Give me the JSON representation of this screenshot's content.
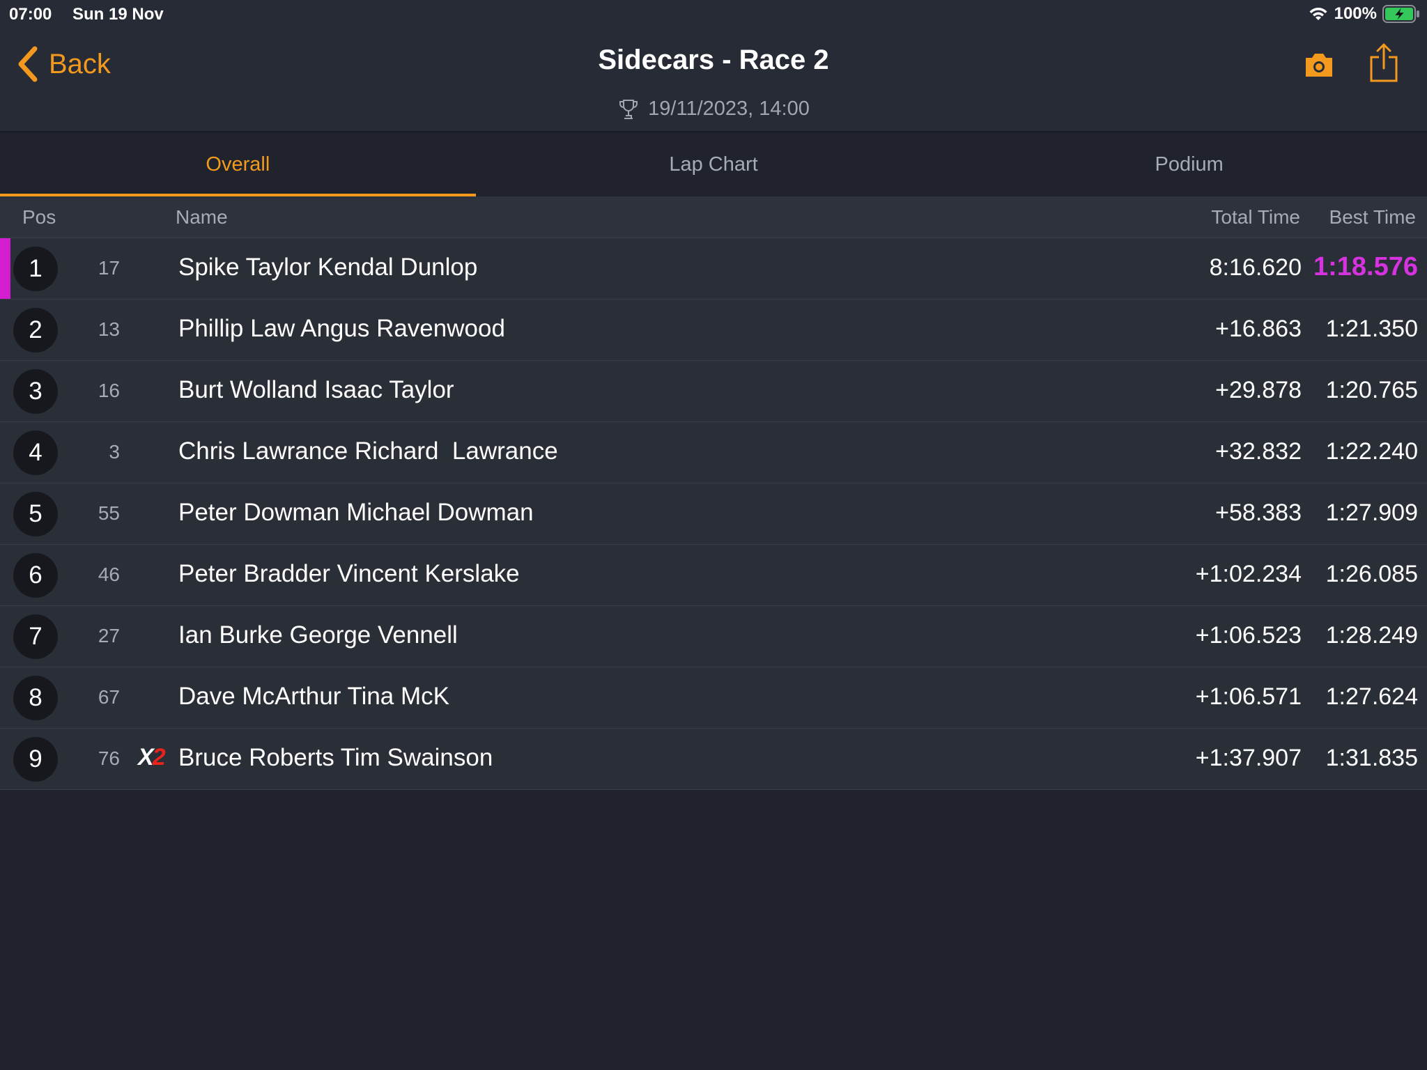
{
  "status_bar": {
    "time": "07:00",
    "date": "Sun 19 Nov",
    "battery": "100%"
  },
  "nav": {
    "back_label": "Back",
    "title": "Sidecars - Race 2",
    "subtitle": "19/11/2023, 14:00",
    "accent_color": "#f39a1e"
  },
  "tabs": [
    {
      "label": "Overall",
      "active": true
    },
    {
      "label": "Lap Chart",
      "active": false
    },
    {
      "label": "Podium",
      "active": false
    }
  ],
  "table": {
    "headers": {
      "pos": "Pos",
      "name": "Name",
      "total_time": "Total Time",
      "best_time": "Best Time"
    },
    "fastest_lap_color": "#d633e0",
    "rows": [
      {
        "pos": "1",
        "number": "17",
        "name": "Spike Taylor Kendal Dunlop",
        "total_time": "8:16.620",
        "best_time": "1:18.576",
        "fastest": true
      },
      {
        "pos": "2",
        "number": "13",
        "name": "Phillip Law Angus Ravenwood",
        "total_time": "+16.863",
        "best_time": "1:21.350"
      },
      {
        "pos": "3",
        "number": "16",
        "name": "Burt Wolland Isaac Taylor",
        "total_time": "+29.878",
        "best_time": "1:20.765"
      },
      {
        "pos": "4",
        "number": "3",
        "name": "Chris Lawrance Richard  Lawrance",
        "total_time": "+32.832",
        "best_time": "1:22.240"
      },
      {
        "pos": "5",
        "number": "55",
        "name": "Peter Dowman Michael Dowman",
        "total_time": "+58.383",
        "best_time": "1:27.909"
      },
      {
        "pos": "6",
        "number": "46",
        "name": "Peter Bradder Vincent Kerslake",
        "total_time": "+1:02.234",
        "best_time": "1:26.085"
      },
      {
        "pos": "7",
        "number": "27",
        "name": "Ian Burke George Vennell",
        "total_time": "+1:06.523",
        "best_time": "1:28.249"
      },
      {
        "pos": "8",
        "number": "67",
        "name": "Dave McArthur Tina McK",
        "total_time": "+1:06.571",
        "best_time": "1:27.624"
      },
      {
        "pos": "9",
        "number": "76",
        "name": "Bruce Roberts Tim Swainson",
        "total_time": "+1:37.907",
        "best_time": "1:31.835",
        "badge": {
          "x": "X",
          "digit": "2"
        }
      }
    ]
  }
}
